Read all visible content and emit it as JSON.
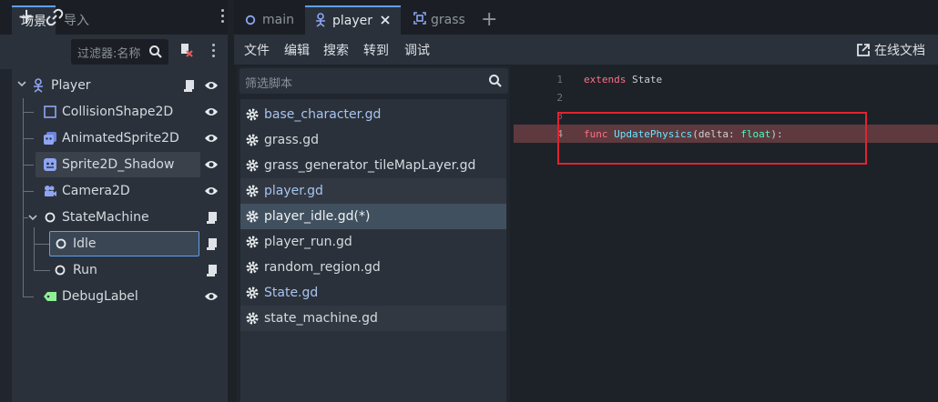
{
  "scene_dock": {
    "tabs": [
      {
        "label": "场景"
      },
      {
        "label": "导入"
      }
    ],
    "filter_placeholder": "过滤器:名称",
    "tree": [
      {
        "label": "Player",
        "icon": "character-body-icon"
      },
      {
        "label": "CollisionShape2D",
        "icon": "collision-shape-icon"
      },
      {
        "label": "AnimatedSprite2D",
        "icon": "animated-sprite-icon"
      },
      {
        "label": "Sprite2D_Shadow",
        "icon": "sprite-icon"
      },
      {
        "label": "Camera2D",
        "icon": "camera-icon"
      },
      {
        "label": "StateMachine",
        "icon": "node-circle-icon"
      },
      {
        "label": "Idle",
        "icon": "node-circle-icon"
      },
      {
        "label": "Run",
        "icon": "node-circle-icon"
      },
      {
        "label": "DebugLabel",
        "icon": "label-icon"
      }
    ]
  },
  "editor": {
    "tabs": [
      {
        "label": "main"
      },
      {
        "label": "player"
      },
      {
        "label": "grass"
      }
    ],
    "menu": [
      {
        "label": "文件"
      },
      {
        "label": "编辑"
      },
      {
        "label": "搜索"
      },
      {
        "label": "转到"
      },
      {
        "label": "调试"
      }
    ],
    "online_docs": "在线文档",
    "script_filter_placeholder": "筛选脚本",
    "scripts": [
      {
        "label": "base_character.gd"
      },
      {
        "label": "grass.gd"
      },
      {
        "label": "grass_generator_tileMapLayer.gd"
      },
      {
        "label": "player.gd"
      },
      {
        "label": "player_idle.gd(*)"
      },
      {
        "label": "player_run.gd"
      },
      {
        "label": "random_region.gd"
      },
      {
        "label": "State.gd"
      },
      {
        "label": "state_machine.gd"
      }
    ],
    "code": {
      "line_numbers": [
        "1",
        "2",
        "3",
        "4"
      ],
      "line1_kw": "extends",
      "line1_rest": " State",
      "line4_kw": "func",
      "line4_fn": "UpdatePhysics",
      "line4_open": "(delta: ",
      "line4_type": "float",
      "line4_close": "):"
    }
  },
  "colors": {
    "accent": "#5ea0ef",
    "keyword": "#ff7085",
    "function": "#66e6ff",
    "type": "#42ffc2",
    "error_line": "#5e3a3f",
    "highlight_box": "#e0242f"
  }
}
